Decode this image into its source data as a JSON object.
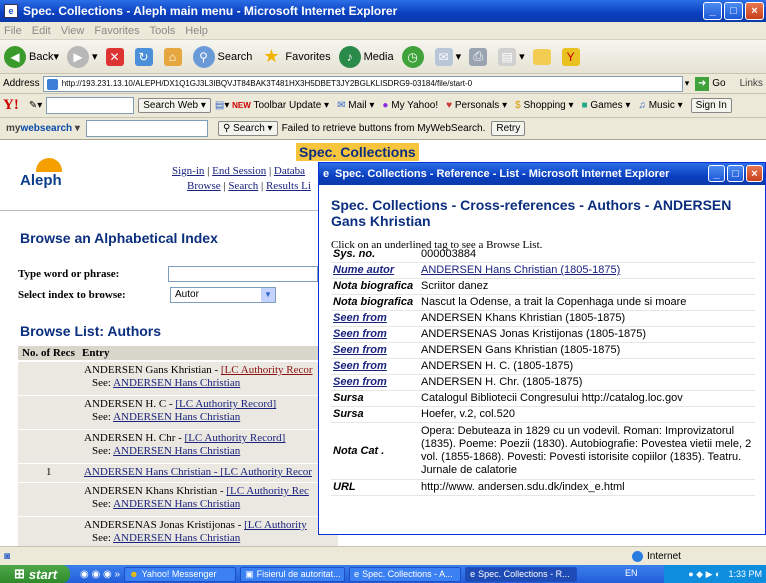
{
  "window": {
    "title": "Spec. Collections - Aleph main menu - Microsoft Internet Explorer"
  },
  "menu": [
    "File",
    "Edit",
    "View",
    "Favorites",
    "Tools",
    "Help"
  ],
  "toolbar": {
    "back": "Back",
    "search": "Search",
    "favorites": "Favorites",
    "media": "Media"
  },
  "address": {
    "label": "Address",
    "url": "http://193.231.13.10/ALEPH/DX1Q1GJ3L3IBQVJT84BAK3T481HX3H5DBET3JY2BGLKLISDRG9-03184/file/start-0",
    "go": "Go",
    "links": "Links"
  },
  "yahoo": {
    "logo": "Y!",
    "search_web": "Search Web",
    "new": "NEW",
    "toolbar_update": "Toolbar Update",
    "mail": "Mail",
    "my_yahoo": "My Yahoo!",
    "personals": "Personals",
    "shopping": "Shopping",
    "games": "Games",
    "music": "Music",
    "sign_in": "Sign In"
  },
  "mws": {
    "brand_a": "my",
    "brand_b": "websearch",
    "search": "Search",
    "message": "Failed to retrieve buttons from MyWebSearch.",
    "retry": "Retry"
  },
  "page": {
    "logo": "Aleph",
    "title": "Spec. Collections",
    "nav1": [
      "Sign-in",
      "End Session",
      "Databa"
    ],
    "nav2": [
      "Browse",
      "Search",
      "Results Li"
    ],
    "browse_heading": "Browse an Alphabetical Index",
    "type_label": "Type word or phrase:",
    "select_label": "Select index to browse:",
    "select_value": "Autor",
    "list_heading": "Browse List: Authors",
    "col_no": "No. of Recs",
    "col_entry": "Entry",
    "rows": [
      {
        "no": "",
        "entry": "ANDERSEN Gans Khristian - ",
        "auth": "[LC Authority Recor",
        "see_label": "See: ",
        "see": "ANDERSEN Hans Christian"
      },
      {
        "no": "",
        "entry": "ANDERSEN H. C - ",
        "auth": "[LC Authority Record]",
        "see_label": "See: ",
        "see": "ANDERSEN Hans Christian"
      },
      {
        "no": "",
        "entry": "ANDERSEN H. Chr - ",
        "auth": "[LC Authority Record]",
        "see_label": "See: ",
        "see": "ANDERSEN Hans Christian"
      },
      {
        "no": "1",
        "entry": "ANDERSEN Hans Christian - ",
        "auth": "[LC Authority Recor",
        "see_label": "",
        "see": ""
      },
      {
        "no": "",
        "entry": "ANDERSEN Khans Khristian - ",
        "auth": "[LC Authority Rec",
        "see_label": "See: ",
        "see": "ANDERSEN Hans Christian"
      },
      {
        "no": "",
        "entry": "ANDERSENAS Jonas Kristijonas - ",
        "auth": "[LC Authority",
        "see_label": "See: ",
        "see": "ANDERSEN Hans Christian"
      }
    ]
  },
  "popup": {
    "title": "Spec. Collections - Reference - List - Microsoft Internet Explorer",
    "heading": "Spec. Collections - Cross-references - Authors - ANDERSEN Gans Khristian",
    "note": "Click on an underlined tag to see a Browse List.",
    "rows": [
      {
        "key": "Sys. no.",
        "value": "000003884"
      },
      {
        "key": "Nume autor",
        "value": "ANDERSEN Hans Christian (1805-1875)"
      },
      {
        "key": "Nota biografica",
        "value": "Scriitor danez"
      },
      {
        "key": "Nota biografica",
        "value": "Nascut la Odense, a trait la Copenhaga unde si moare"
      },
      {
        "key": "Seen from",
        "value": "ANDERSEN Khans Khristian (1805-1875)"
      },
      {
        "key": "Seen from",
        "value": "ANDERSENAS Jonas Kristijonas (1805-1875)"
      },
      {
        "key": "Seen from",
        "value": "ANDERSEN Gans Khristian (1805-1875)"
      },
      {
        "key": "Seen from",
        "value": "ANDERSEN H. C. (1805-1875)"
      },
      {
        "key": "Seen from",
        "value": "ANDERSEN H. Chr. (1805-1875)"
      },
      {
        "key": "Sursa",
        "value": "Catalogul Bibliotecii Congresului http://catalog.loc.gov"
      },
      {
        "key": "Sursa",
        "value": "Hoefer, v.2, col.520"
      },
      {
        "key": "Nota Cat .",
        "value": "Opera: Debuteaza in 1829 cu un vodevil. Roman: Improvizatorul (1835). Poeme: Poezii (1830). Autobiografie: Povestea vietii mele, 2 vol. (1855-1868). Povesti: Povesti istorisite copiilor (1835). Teatru. Jurnale de calatorie"
      },
      {
        "key": "URL",
        "value": "http://www. andersen.sdu.dk/index_e.html"
      }
    ]
  },
  "status": {
    "zone": "Internet"
  },
  "taskbar": {
    "start": "start",
    "items": [
      "Yahoo! Messenger",
      "Fisierul de autoritat...",
      "Spec. Collections - A...",
      "Spec. Collections - R..."
    ],
    "lang": "EN",
    "time": "1:33 PM"
  }
}
